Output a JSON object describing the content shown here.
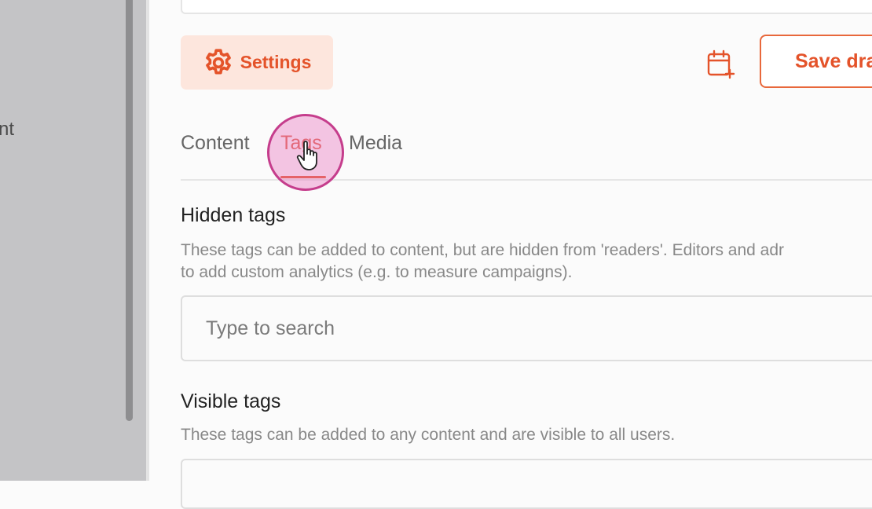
{
  "sidebar": {
    "nav_fragment": "nt"
  },
  "toolbar": {
    "settings_label": "Settings",
    "schedule_icon": "calendar-plus-icon",
    "save_label": "Save dra"
  },
  "tabs": [
    {
      "label": "Content",
      "active": false
    },
    {
      "label": "Tags",
      "active": true
    },
    {
      "label": "Media",
      "active": false
    }
  ],
  "hidden_tags": {
    "title": "Hidden tags",
    "description_line1": "These tags can be added to content, but are hidden from 'readers'. Editors and adr",
    "description_line2": "to add custom analytics (e.g. to measure campaigns).",
    "search_placeholder": "Type to search"
  },
  "visible_tags": {
    "title": "Visible tags",
    "description": "These tags can be added to any content and are visible to all users."
  },
  "colors": {
    "accent": "#e4532a",
    "accent_soft": "#fde6dd",
    "click_highlight": "#e878be"
  }
}
